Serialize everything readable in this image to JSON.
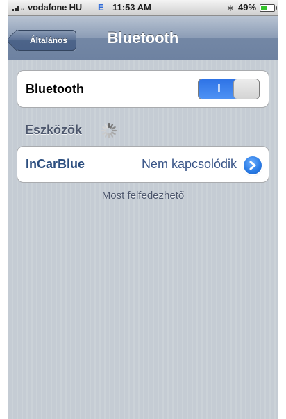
{
  "status_bar": {
    "carrier": "vodafone HU",
    "network": "E",
    "time": "11:53 AM",
    "bluetooth_icon": "bluetooth-icon",
    "battery_percent": "49%",
    "battery_level": 0.49
  },
  "nav": {
    "back_label": "Általános",
    "title": "Bluetooth"
  },
  "bluetooth": {
    "label": "Bluetooth",
    "toggle_state": "I",
    "enabled": true
  },
  "devices": {
    "header": "Eszközök",
    "items": [
      {
        "name": "InCarBlue",
        "status": "Nem kapcsolódik"
      }
    ]
  },
  "footer": "Most felfedezhető",
  "colors": {
    "accent": "#2e73e6",
    "nav_bar": "#6e82a1",
    "background": "#c5ccd4",
    "device_name": "#2d4f80"
  }
}
